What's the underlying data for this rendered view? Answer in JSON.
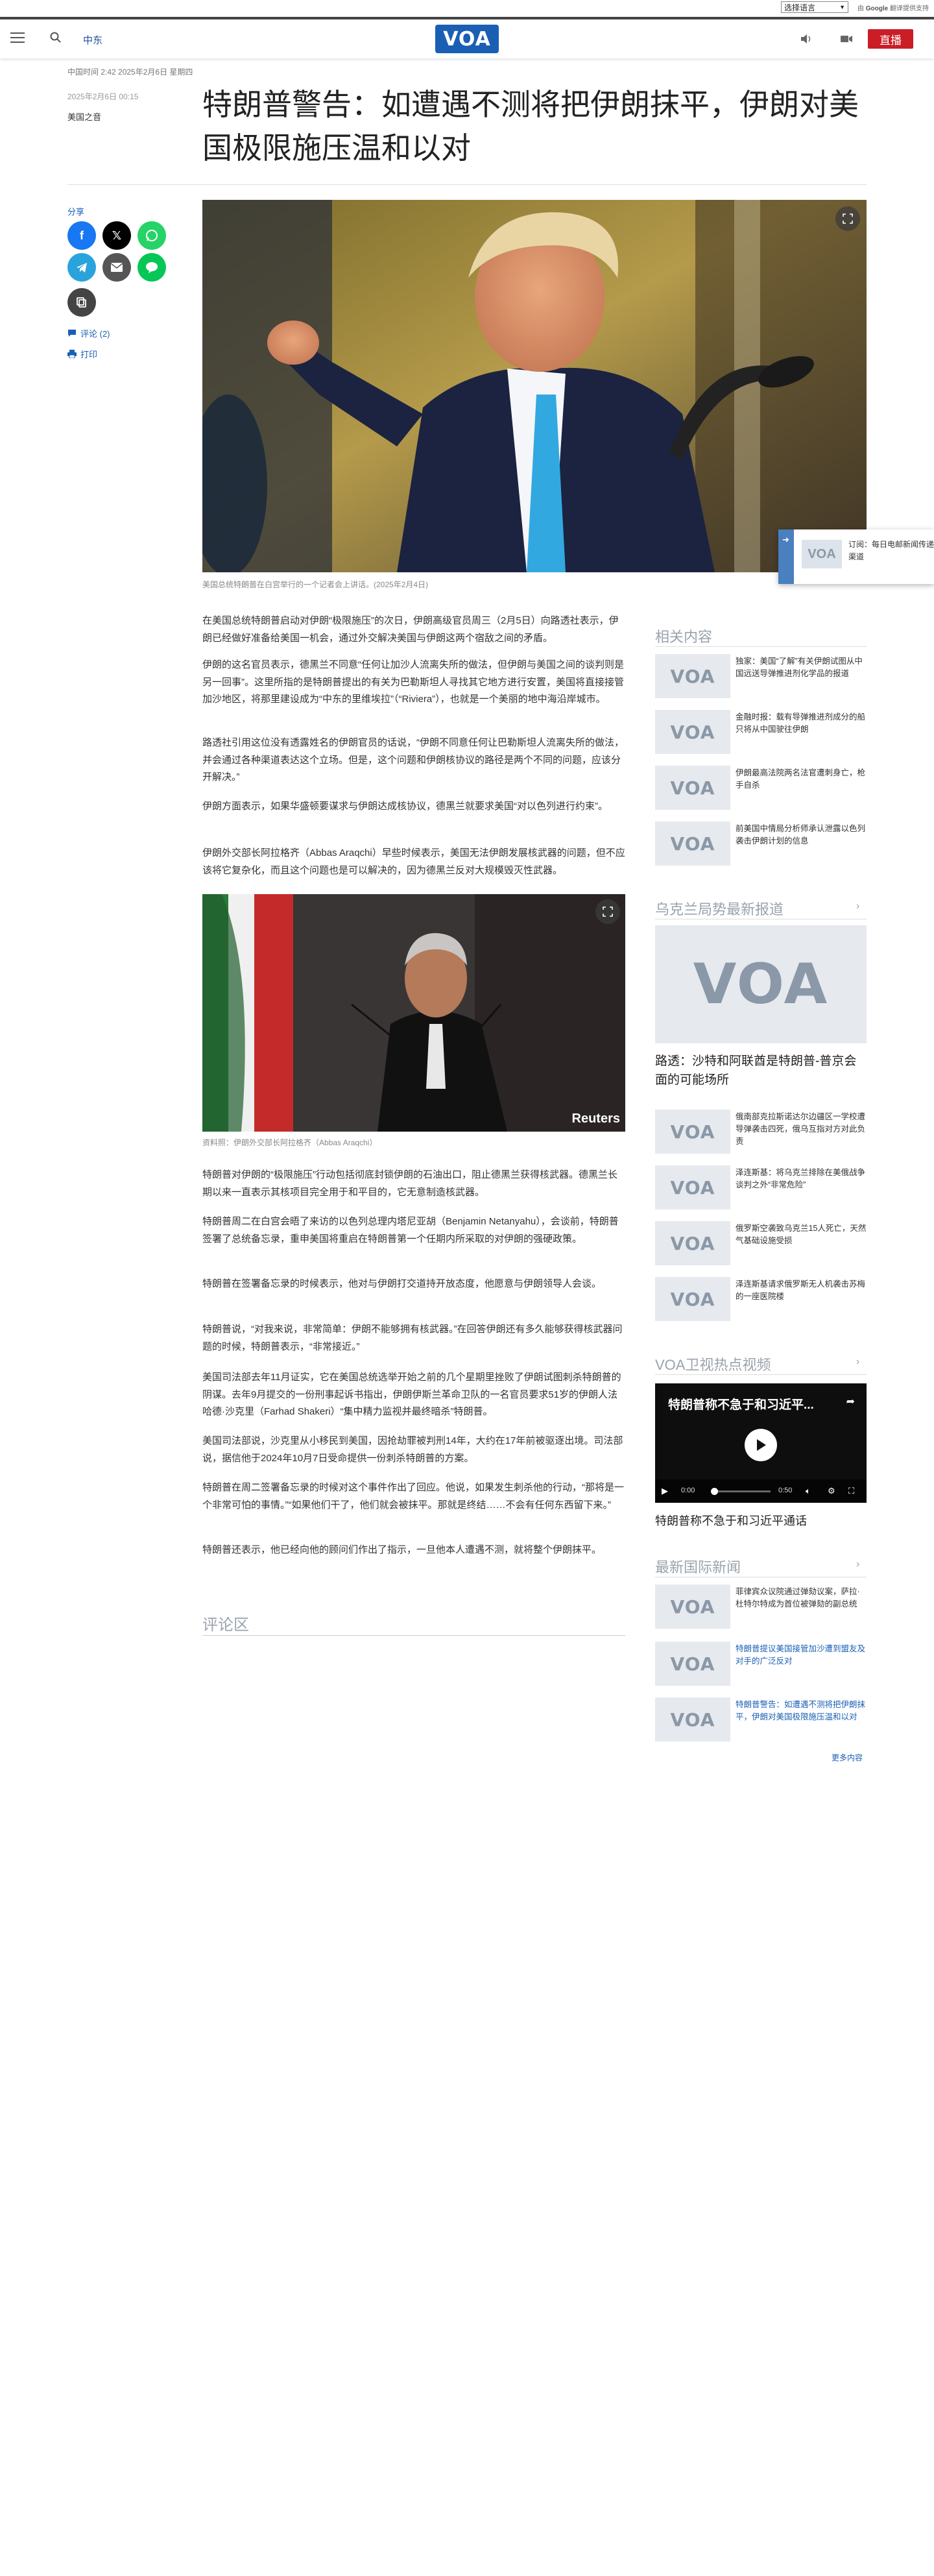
{
  "translate": {
    "select_label": "选择语言",
    "powered_prefix": "由",
    "google": "Google",
    "suffix": "翻译提供支持"
  },
  "header": {
    "section": "中东",
    "logo": "VOA",
    "live": "直播"
  },
  "article": {
    "timestamp": "中国时间 2:42 2025年2月6日 星期四",
    "updated": "2025年2月6日 00:15",
    "author": "美国之音",
    "headline": "特朗普警告：如遭遇不测将把伊朗抹平，伊朗对美国极限施压温和以对",
    "hero_caption": "美国总统特朗普在白宫举行的一个记者会上讲话。(2025年2月4日)",
    "inline_caption": "资料照：伊朗外交部长阿拉格齐（Abbas Araqchi）",
    "inline_watermark": "Reuters",
    "paragraphs": [
      "在美国总统特朗普启动对伊朗“极限施压”的次日，伊朗高级官员周三（2月5日）向路透社表示，伊朗已经做好准备给美国一机会，通过外交解决美国与伊朗这两个宿敌之间的矛盾。",
      "伊朗的这名官员表示，德黑兰不同意“任何让加沙人流离失所的做法，但伊朗与美国之间的谈判则是另一回事”。这里所指的是特朗普提出的有关为巴勒斯坦人寻找其它地方进行安置，美国将直接接管加沙地区，将那里建设成为“中东的里维埃拉”（“Riviera”），也就是一个美丽的地中海沿岸城市。",
      "路透社引用这位没有透露姓名的伊朗官员的话说，“伊朗不同意任何让巴勒斯坦人流离失所的做法，并会通过各种渠道表达这个立场。但是，这个问题和伊朗核协议的路径是两个不同的问题，应该分开解决。”",
      "伊朗方面表示，如果华盛顿要谋求与伊朗达成核协议，德黑兰就要求美国“对以色列进行约束”。",
      "伊朗外交部长阿拉格齐（Abbas Araqchi）早些时候表示，美国无法伊朗发展核武器的问题，但不应该将它复杂化，而且这个问题也是可以解决的，因为德黑兰反对大规模毁灭性武器。",
      "特朗普对伊朗的“极限施压”行动包括彻底封锁伊朗的石油出口，阻止德黑兰获得核武器。德黑兰长期以来一直表示其核项目完全用于和平目的，它无意制造核武器。",
      "特朗普周二在白宫会晤了来访的以色列总理内塔尼亚胡（Benjamin Netanyahu），会谈前，特朗普签署了总统备忘录，重申美国将重启在特朗普第一个任期内所采取的对伊朗的强硬政策。",
      "特朗普在签署备忘录的时候表示，他对与伊朗打交道持开放态度，他愿意与伊朗领导人会谈。",
      "特朗普说，“对我来说，非常简单：伊朗不能够拥有核武器。”在回答伊朗还有多久能够获得核武器问题的时候，特朗普表示，“非常接近。”",
      "美国司法部去年11月证实，它在美国总统选举开始之前的几个星期里挫败了伊朗试图刺杀特朗普的阴谋。去年9月提交的一份刑事起诉书指出，伊朗伊斯兰革命卫队的一名官员要求51岁的伊朗人法哈德·沙克里（Farhad Shakeri）“集中精力监视并最终暗杀”特朗普。",
      "美国司法部说，沙克里从小移民到美国，因抢劫罪被判刑14年，大约在17年前被驱逐出境。司法部说，据信他于2024年10月7日受命提供一份刺杀特朗普的方案。",
      "特朗普在周二签署备忘录的时候对这个事件作出了回应。他说，如果发生刺杀他的行动，“那将是一个非常可怕的事情。”“如果他们干了，他们就会被抹平。那就是终结……不会有任何东西留下来。”",
      "特朗普还表示，他已经向他的顾问们作出了指示，一旦他本人遭遇不测，就将整个伊朗抹平。"
    ],
    "comments_heading": "评论区"
  },
  "share": {
    "label": "分享",
    "comments": "评论 (2)",
    "print": "打印"
  },
  "subscribe": {
    "logo": "VOA",
    "text": "订阅：每日电邮新闻传递渠道"
  },
  "sidebar": {
    "related_title": "相关内容",
    "related": [
      {
        "thumb": "VOA",
        "text": "独家：美国“了解”有关伊朗试图从中国远送导弹推进剂化学品的报道"
      },
      {
        "thumb": "VOA",
        "text": "金融时报：载有导弹推进剂成分的船只将从中国驶往伊朗"
      },
      {
        "thumb": "VOA",
        "text": "伊朗最高法院两名法官遭刺身亡，枪手自杀"
      },
      {
        "thumb": "VOA",
        "text": "前美国中情局分析师承认泄露以色列袭击伊朗计划的信息"
      }
    ],
    "ukraine_title": "乌克兰局势最新报道",
    "ukraine_lead_thumb": "VOA",
    "ukraine_lead": "路透：沙特和阿联酋是特朗普-普京会面的可能场所",
    "ukraine": [
      {
        "thumb": "VOA",
        "text": "俄南部克拉斯诺达尔边疆区一学校遭导弹袭击四死，俄乌互指对方对此负责"
      },
      {
        "thumb": "VOA",
        "text": "泽连斯基：将乌克兰排除在美俄战争谈判之外“非常危险”"
      },
      {
        "thumb": "VOA",
        "text": "俄罗斯空袭致乌克兰15人死亡，天然气基础设施受损"
      },
      {
        "thumb": "VOA",
        "text": "泽连斯基请求俄罗斯无人机袭击苏梅的一座医院楼"
      }
    ],
    "video_title": "VOA卫视热点视频",
    "video": {
      "overlay_title": "特朗普称不急于和习近平...",
      "time_current": "0:00",
      "time_total": "0:50",
      "progress": 0,
      "caption": "特朗普称不急于和习近平通话"
    },
    "intl_title": "最新国际新闻",
    "intl": [
      {
        "thumb": "VOA",
        "text": "菲律宾众议院通过弹劾议案，萨拉·杜特尔特成为首位被弹劾的副总统"
      },
      {
        "thumb": "VOA",
        "text": "特朗普提议美国接管加沙遭到盟友及对手的广泛反对"
      },
      {
        "thumb": "VOA",
        "text": "特朗普警告：如遭遇不测将把伊朗抹平，伊朗对美国极限施压温和以对"
      }
    ],
    "more": "更多内容"
  },
  "colors": {
    "brand_blue": "#1a5fb4",
    "live_red": "#cb1d25",
    "sidebar_heading": "#9aa3ad"
  },
  "icons": [
    "menu-icon",
    "search-icon",
    "audio-icon",
    "video-icon",
    "facebook-icon",
    "x-icon",
    "whatsapp-icon",
    "telegram-icon",
    "email-icon",
    "line-icon",
    "copy-link-icon",
    "comment-icon",
    "print-icon",
    "expand-icon",
    "play-icon",
    "share-icon",
    "volume-icon",
    "settings-icon",
    "fullscreen-icon"
  ]
}
